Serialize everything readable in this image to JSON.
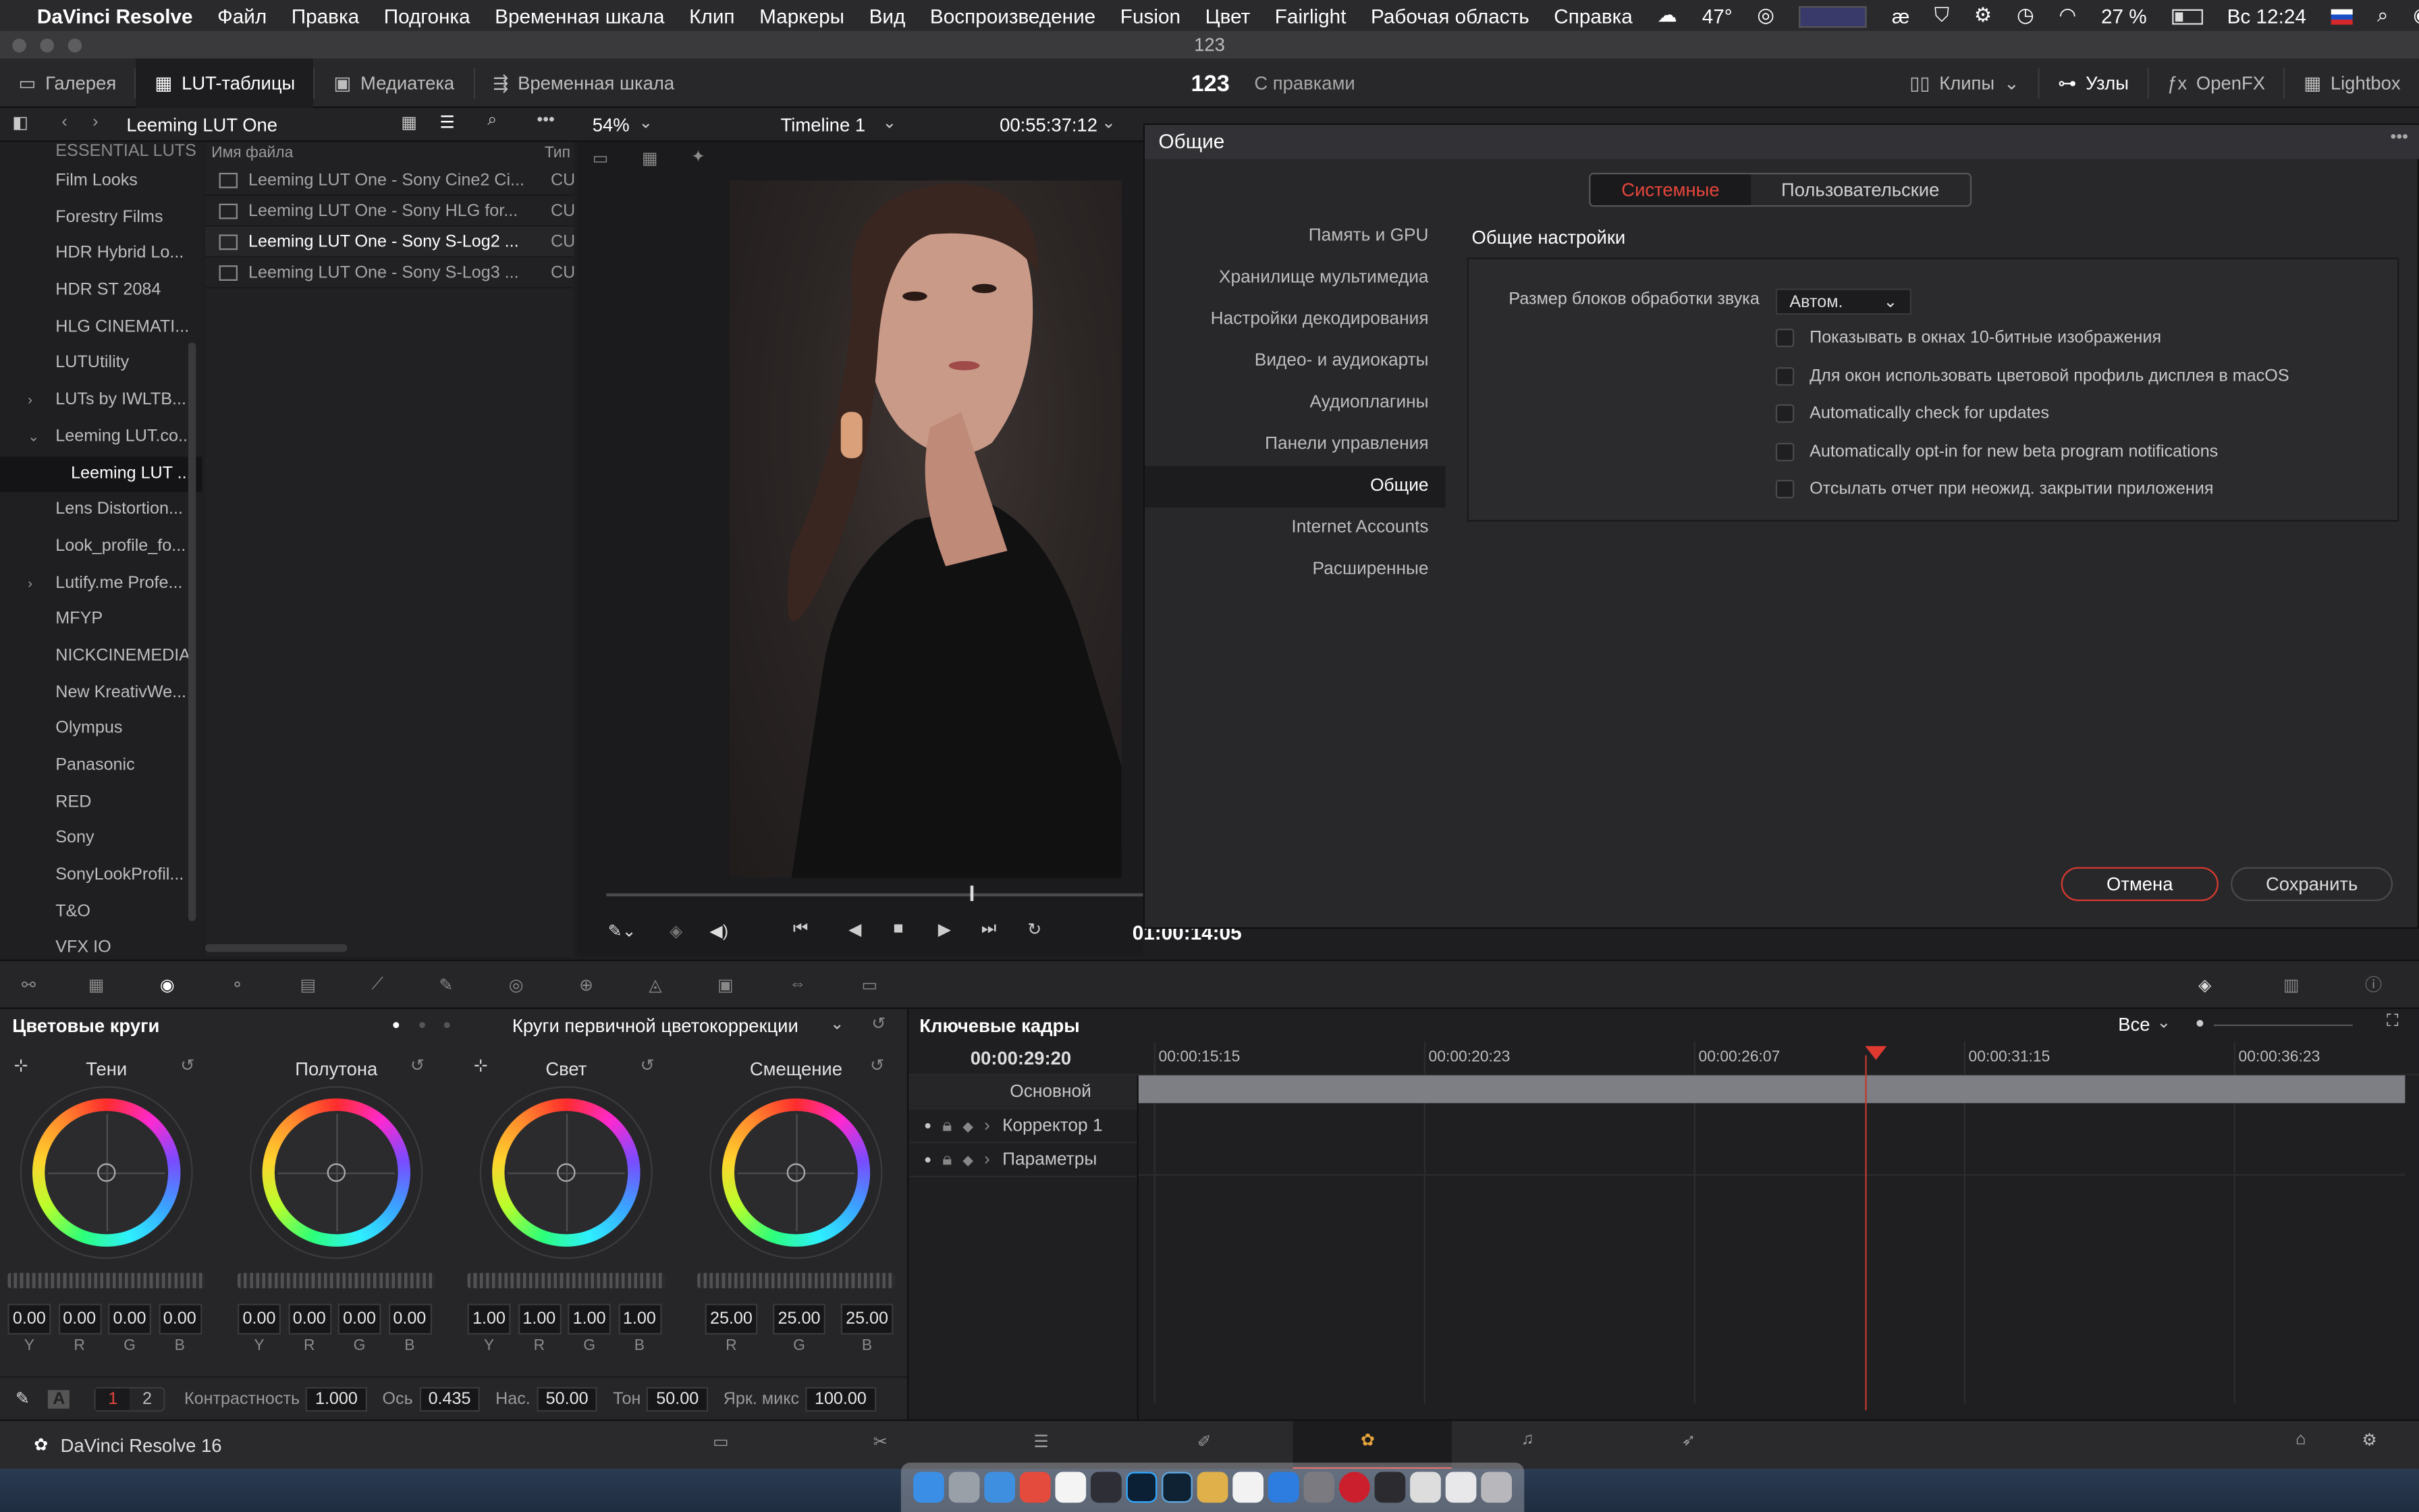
{
  "menubar": {
    "apple": "",
    "app": "DaVinci Resolve",
    "items": [
      "Файл",
      "Правка",
      "Подгонка",
      "Временная шкала",
      "Клип",
      "Маркеры",
      "Вид",
      "Воспроизведение",
      "Fusion",
      "Цвет",
      "Fairlight",
      "Рабочая область",
      "Справка"
    ],
    "weather": "47°",
    "battery": "27 %",
    "clock": "Вс 12:24"
  },
  "window": {
    "title": "123"
  },
  "toolbar": {
    "gallery": "Галерея",
    "luts": "LUT-таблицы",
    "media": "Медиатека",
    "timeline": "Временная шкала",
    "project": "123",
    "project_status": "С правками",
    "clips": "Клипы",
    "nodes": "Узлы",
    "openfx": "OpenFX",
    "lightbox": "Lightbox"
  },
  "lut_panel": {
    "title": "Leeming LUT One",
    "zoom": "54%",
    "timeline_name": "Timeline 1",
    "timecode": "00:55:37:12"
  },
  "tree": [
    {
      "label": "ESSENTIAL LUTS",
      "arrow": ""
    },
    {
      "label": "Film Looks",
      "arrow": ""
    },
    {
      "label": "Forestry Films",
      "arrow": ""
    },
    {
      "label": "HDR Hybrid Lo...",
      "arrow": ""
    },
    {
      "label": "HDR ST 2084",
      "arrow": ""
    },
    {
      "label": "HLG CINEMATI...",
      "arrow": ""
    },
    {
      "label": "LUTUtility",
      "arrow": ""
    },
    {
      "label": "LUTs by IWLTB...",
      "arrow": "›"
    },
    {
      "label": "Leeming LUT.co...",
      "arrow": "⌄"
    },
    {
      "label": "Leeming LUT ...",
      "arrow": "",
      "sel": true
    },
    {
      "label": "Lens Distortion...",
      "arrow": ""
    },
    {
      "label": "Look_profile_fo...",
      "arrow": ""
    },
    {
      "label": "Lutify.me Profe...",
      "arrow": "›"
    },
    {
      "label": "MFYP",
      "arrow": ""
    },
    {
      "label": "NICKCINEMEDIA",
      "arrow": ""
    },
    {
      "label": "New KreativWe...",
      "arrow": ""
    },
    {
      "label": "Olympus",
      "arrow": ""
    },
    {
      "label": "Panasonic",
      "arrow": ""
    },
    {
      "label": "RED",
      "arrow": ""
    },
    {
      "label": "Sony",
      "arrow": ""
    },
    {
      "label": "SonyLookProfil...",
      "arrow": ""
    },
    {
      "label": "T&O",
      "arrow": ""
    },
    {
      "label": "VFX IO",
      "arrow": ""
    }
  ],
  "files": {
    "col_name": "Имя файла",
    "col_type": "Тип",
    "rows": [
      {
        "name": "Leeming LUT One - Sony Cine2 Ci...",
        "type": "CU"
      },
      {
        "name": "Leeming LUT One - Sony HLG for...",
        "type": "CU"
      },
      {
        "name": "Leeming LUT One - Sony S-Log2 ...",
        "type": "CU",
        "sel": true
      },
      {
        "name": "Leeming LUT One - Sony S-Log3 ...",
        "type": "CU"
      }
    ]
  },
  "viewer": {
    "timecode": "01:00:14:05"
  },
  "dialog": {
    "title": "Общие",
    "tab_system": "Системные",
    "tab_user": "Пользовательские",
    "nav": [
      "Память и GPU",
      "Хранилище мультимедиа",
      "Настройки декодирования",
      "Видео- и аудиокарты",
      "Аудиоплагины",
      "Панели управления",
      "Общие",
      "Internet Accounts",
      "Расширенные"
    ],
    "nav_selected": 6,
    "section_title": "Общие настройки",
    "audio_block_label": "Размер блоков обработки звука",
    "audio_block_value": "Автом.",
    "checks": [
      "Показывать в окнах 10-битные изображения",
      "Для окон использовать цветовой профиль дисплея в macOS",
      "Automatically check for updates",
      "Automatically opt-in for new beta program notifications",
      "Отсылать отчет при неожид. закрытии приложения"
    ],
    "cancel": "Отмена",
    "save": "Сохранить"
  },
  "color": {
    "title": "Цветовые круги",
    "mode": "Круги первичной цветокоррекции",
    "wheels": [
      {
        "label": "Тени",
        "values": [
          "0.00",
          "0.00",
          "0.00",
          "0.00"
        ],
        "channels": [
          "Y",
          "R",
          "G",
          "B"
        ]
      },
      {
        "label": "Полутона",
        "values": [
          "0.00",
          "0.00",
          "0.00",
          "0.00"
        ],
        "channels": [
          "Y",
          "R",
          "G",
          "B"
        ]
      },
      {
        "label": "Свет",
        "values": [
          "1.00",
          "1.00",
          "1.00",
          "1.00"
        ],
        "channels": [
          "Y",
          "R",
          "G",
          "B"
        ]
      },
      {
        "label": "Смещение",
        "values": [
          "25.00",
          "25.00",
          "25.00"
        ],
        "channels": [
          "R",
          "G",
          "B"
        ]
      }
    ],
    "page1": "1",
    "page2": "2",
    "contrast_label": "Контрастность",
    "contrast": "1.000",
    "pivot_label": "Ось",
    "pivot": "0.435",
    "sat_label": "Нас.",
    "sat": "50.00",
    "hue_label": "Тон",
    "hue": "50.00",
    "lummix_label": "Ярк. микс",
    "lummix": "100.00"
  },
  "keyframes": {
    "title": "Ключевые кадры",
    "filter": "Все",
    "current_time": "00:00:29:20",
    "ruler": [
      "00:00:15:15",
      "00:00:20:23",
      "00:00:26:07",
      "00:00:31:15",
      "00:00:36:23"
    ],
    "rows": [
      "Основной",
      "Корректор 1",
      "Параметры"
    ]
  },
  "footer": {
    "app_name": "DaVinci Resolve 16"
  },
  "colors": {
    "accent": "#e6463c",
    "playhead": "#e03a30"
  }
}
